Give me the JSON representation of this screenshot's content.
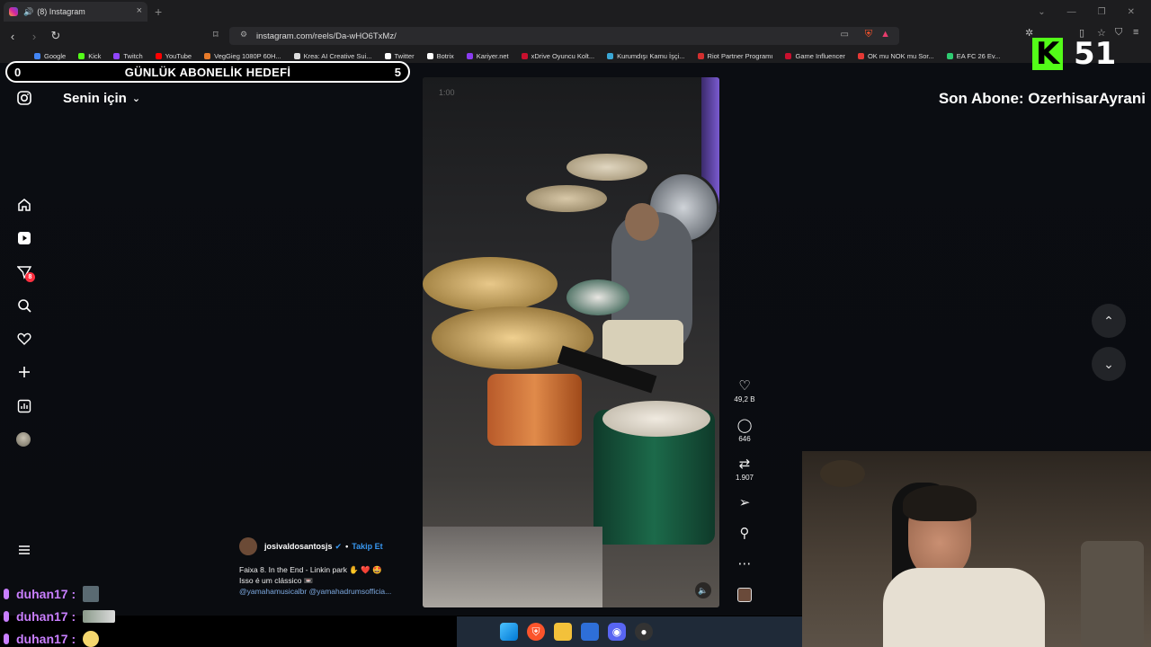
{
  "browser": {
    "tab_title": "(8) Instagram",
    "url": "instagram.com/reels/Da-wHO6TxMz/",
    "bookmarks": [
      {
        "label": "Google",
        "color": "#4285f4"
      },
      {
        "label": "Kick",
        "color": "#53fc18"
      },
      {
        "label": "Twitch",
        "color": "#9146ff"
      },
      {
        "label": "YouTube",
        "color": "#ff0000"
      },
      {
        "label": "VegGieg 1080P 60H...",
        "color": "#e87b2a"
      },
      {
        "label": "Krea: AI Creative Sui...",
        "color": "#ddd"
      },
      {
        "label": "Twitter",
        "color": "#fff"
      },
      {
        "label": "Botrix",
        "color": "#fff"
      },
      {
        "label": "Kariyer.net",
        "color": "#8a3cf0"
      },
      {
        "label": "xDrive Oyuncu Kolt...",
        "color": "#c8102e"
      },
      {
        "label": "Kurumdışı Kamu İşçi...",
        "color": "#3aa7d6"
      },
      {
        "label": "Riot Partner Programı",
        "color": "#d32f2f"
      },
      {
        "label": "Game Influencer",
        "color": "#c8102e"
      },
      {
        "label": "OK mu NOK mu Sor...",
        "color": "#e53935"
      },
      {
        "label": "EA FC 26 Ev...",
        "color": "#2ecc71"
      }
    ]
  },
  "overlay": {
    "goal_title": "GÜNLÜK ABONELİK HEDEFİ",
    "goal_current": "0",
    "goal_target": "5",
    "kick_count": "51",
    "last_sub": "Son Abone: OzerhisarAyrani"
  },
  "instagram": {
    "feed_label": "Senin için",
    "notification_count": "8",
    "author": "josivaldosantosjs",
    "follow_label": "Takip Et",
    "caption_line1": "Faixa 8. In the End - Linkin park ✋ ❤️ 🤩",
    "caption_line2": "Isso é um clássico 📼",
    "caption_tags": "@yamahamusicalbr @yamahadrumsofficia...",
    "likes": "49,2 B",
    "comments": "646",
    "reposts": "1.907",
    "video_timestamp": "1:00"
  },
  "chat": [
    {
      "user": "duhan17 :"
    },
    {
      "user": "duhan17 :"
    },
    {
      "user": "duhan17 :"
    }
  ]
}
